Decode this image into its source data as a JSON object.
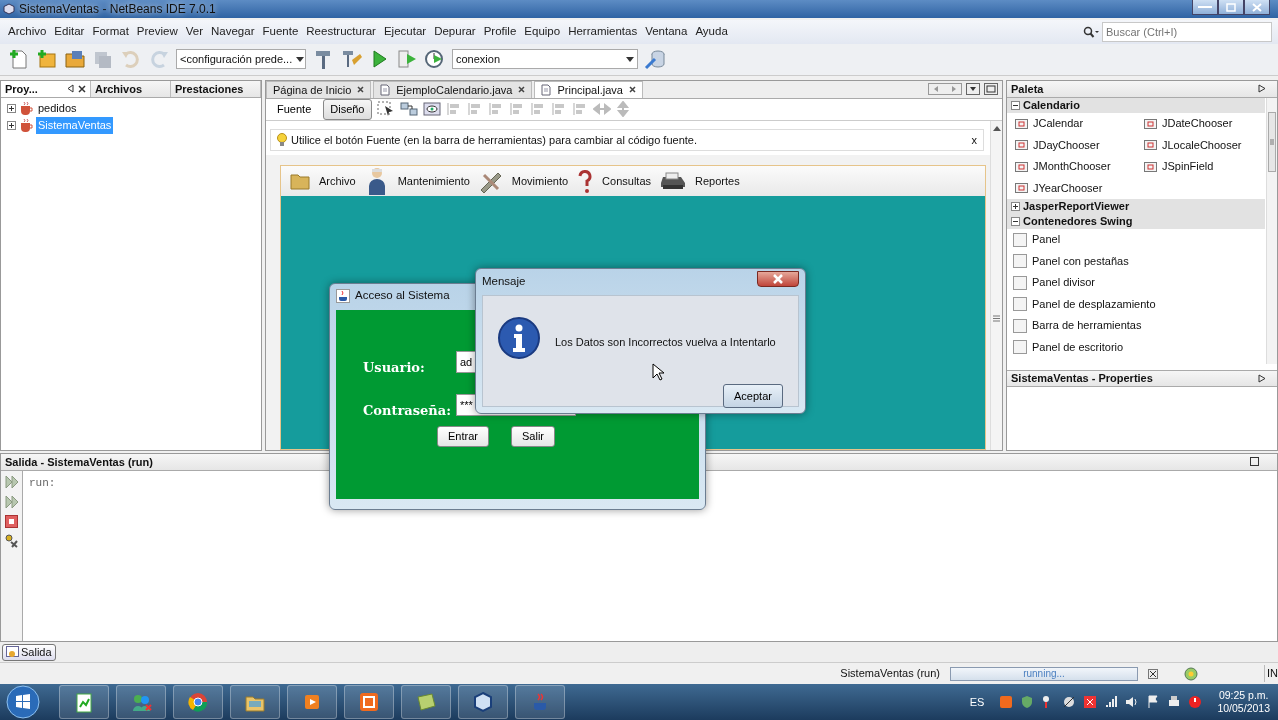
{
  "window": {
    "title": "SistemaVentas - NetBeans IDE 7.0.1"
  },
  "menu": [
    "Archivo",
    "Editar",
    "Format",
    "Preview",
    "Ver",
    "Navegar",
    "Fuente",
    "Reestructurar",
    "Ejecutar",
    "Depurar",
    "Profile",
    "Equipo",
    "Herramientas",
    "Ventana",
    "Ayuda"
  ],
  "search": {
    "placeholder": "Buscar (Ctrl+I)"
  },
  "toolbar": {
    "configuration": "<configuración prede...",
    "project": "conexion"
  },
  "left_tabs": [
    {
      "label": "Proy...",
      "selected": true
    },
    {
      "label": "Archivos",
      "selected": false
    },
    {
      "label": "Prestaciones",
      "selected": false
    }
  ],
  "projects": [
    {
      "name": "pedidos",
      "selected": false
    },
    {
      "name": "SistemaVentas",
      "selected": true
    }
  ],
  "editor_tabs": [
    {
      "label": "Página de Inicio",
      "selected": false
    },
    {
      "label": "EjemploCalendario.java",
      "selected": false
    },
    {
      "label": "Principal.java",
      "selected": true
    }
  ],
  "view_modes": [
    {
      "label": "Fuente",
      "selected": false
    },
    {
      "label": "Diseño",
      "selected": true
    }
  ],
  "hint": {
    "text": "Utilice el botón Fuente (en la barra de herramientas) para cambiar al código fuente.",
    "close": "x"
  },
  "app_menu": [
    "Archivo",
    "Mantenimiento",
    "Movimiento",
    "Consultas",
    "Reportes"
  ],
  "login": {
    "title": "Acceso al Sistema",
    "user_label": "Usuario:",
    "user_value": "ad",
    "password_label": "Contraseña:",
    "password_value": "***",
    "buttons": [
      "Entrar",
      "Salir"
    ]
  },
  "message": {
    "title": "Mensaje",
    "text": "Los Datos son Incorrectos vuelva a Intentarlo",
    "button": "Aceptar"
  },
  "palette": {
    "title": "Paleta",
    "groups": [
      {
        "name": "Calendario",
        "expanded": true,
        "kind": "grid",
        "items": [
          "JCalendar",
          "JDateChooser",
          "JDayChooser",
          "JLocaleChooser",
          "JMonthChooser",
          "JSpinField",
          "JYearChooser"
        ]
      },
      {
        "name": "JasperReportViewer",
        "expanded": false
      },
      {
        "name": "Contenedores Swing",
        "expanded": true,
        "kind": "list",
        "items": [
          "Panel",
          "Panel con pestañas",
          "Panel divisor",
          "Panel de desplazamiento",
          "Barra de herramientas",
          "Panel de escritorio"
        ]
      }
    ]
  },
  "properties": {
    "title": "SistemaVentas - Properties"
  },
  "output": {
    "title": "Salida - SistemaVentas (run)",
    "lines": [
      "run:"
    ]
  },
  "bottom_tabs": [
    "Salida"
  ],
  "status": {
    "task": "SistemaVentas (run)",
    "progress": "running...",
    "level": 1,
    "mode": "IN"
  },
  "taskbar": {
    "language": "ES",
    "time": "09:25 p.m.",
    "date": "10/05/2013"
  }
}
